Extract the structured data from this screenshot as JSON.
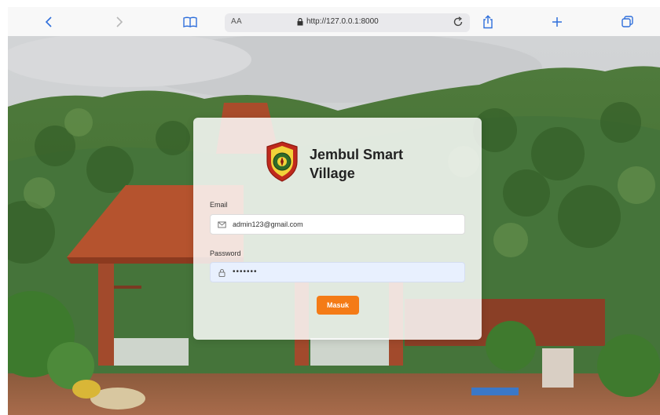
{
  "browser": {
    "text_size_label": "AA",
    "url": "http://127.0.0.1:8000",
    "icons": {
      "back": "chevron-left-icon",
      "forward": "chevron-right-icon",
      "bookmarks": "book-icon",
      "lock": "lock-icon",
      "reload": "reload-icon",
      "share": "share-icon",
      "new_tab": "plus-icon",
      "tabs": "tabs-icon"
    },
    "accent_color": "#2f6fdb"
  },
  "login": {
    "app_name": "Jembul Smart Village",
    "email_label": "Email",
    "email_value": "admin123@gmail.com",
    "password_label": "Password",
    "password_value": "•••••••",
    "submit_label": "Masuk",
    "submit_color": "#f47b16"
  }
}
